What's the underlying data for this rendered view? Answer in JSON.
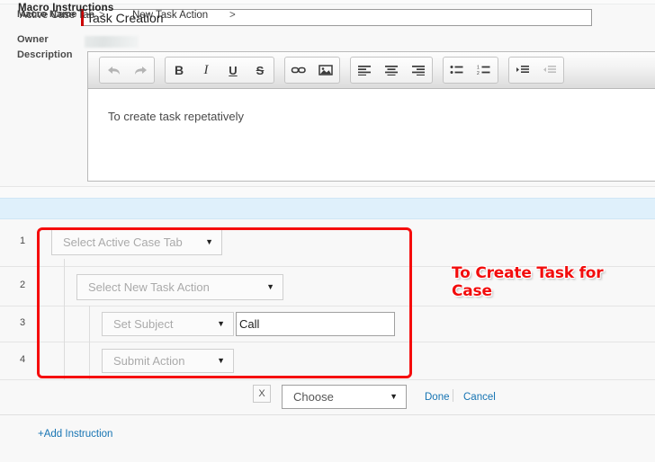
{
  "form": {
    "macro_name_label": "Macro Name",
    "macro_name_value": "Task Creation",
    "owner_label": "Owner",
    "owner_value": "",
    "description_label": "Description",
    "description_text": "To create task repetatively"
  },
  "editor_toolbar": {
    "groups": [
      {
        "buttons": [
          {
            "name": "undo-icon",
            "label": "undo",
            "dim": true
          },
          {
            "name": "redo-icon",
            "label": "redo",
            "dim": true
          }
        ]
      },
      {
        "buttons": [
          {
            "name": "bold-icon",
            "label": "B"
          },
          {
            "name": "italic-icon",
            "label": "I"
          },
          {
            "name": "underline-icon",
            "label": "U"
          },
          {
            "name": "strikethrough-icon",
            "label": "S"
          }
        ]
      },
      {
        "buttons": [
          {
            "name": "link-icon",
            "label": "link"
          },
          {
            "name": "image-icon",
            "label": "image"
          }
        ]
      },
      {
        "buttons": [
          {
            "name": "align-left-icon",
            "label": "align left"
          },
          {
            "name": "align-center-icon",
            "label": "align center"
          },
          {
            "name": "align-right-icon",
            "label": "align right"
          }
        ]
      },
      {
        "buttons": [
          {
            "name": "bullet-list-icon",
            "label": "bulleted list"
          },
          {
            "name": "numbered-list-icon",
            "label": "numbered list"
          }
        ]
      },
      {
        "buttons": [
          {
            "name": "indent-icon",
            "label": "indent"
          },
          {
            "name": "outdent-icon",
            "label": "outdent",
            "dim": true
          }
        ]
      }
    ]
  },
  "instructions_section": {
    "title": "Macro Instructions",
    "rows": [
      {
        "number": "1",
        "select_value": "Select Active Case Tab",
        "caret": "▼"
      },
      {
        "number": "2",
        "select_value": "Select New Task Action",
        "caret": "▼"
      },
      {
        "number": "3",
        "select_value": "Set Subject",
        "caret": "▼",
        "text_value": "Call"
      },
      {
        "number": "4",
        "select_value": "Submit Action",
        "caret": "▼"
      }
    ]
  },
  "breadcrumb": {
    "crumb_1": "Active Case Tab",
    "separator_1": ">",
    "crumb_2": "New Task Action",
    "separator_2": ">",
    "remove_label": "X",
    "choose_value": "Choose",
    "choose_caret": "▼",
    "done_label": "Done",
    "cancel_label": "Cancel"
  },
  "footer": {
    "add_instruction_label": "+Add Instruction"
  },
  "annotation": {
    "text": "To Create Task for Case",
    "color": "#f20d0d"
  },
  "colors": {
    "section_header_bg": "#dff0fb",
    "link": "#1674b3",
    "required_marker": "#cc0000",
    "annotation_red": "#f20d0d"
  }
}
